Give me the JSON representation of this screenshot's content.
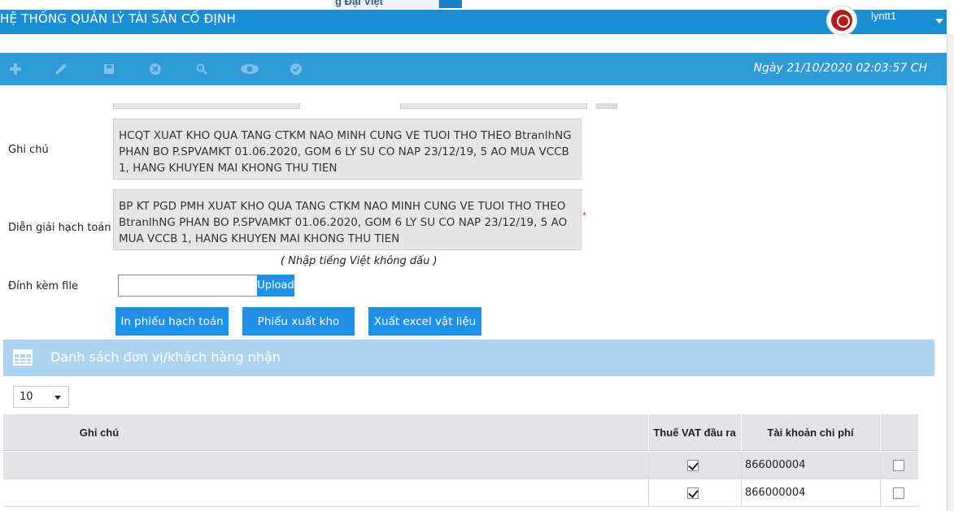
{
  "top_tab": {
    "label": "g Đại Việt"
  },
  "header": {
    "title": "HỆ THỐNG QUẢN LÝ TÀI SẢN CỐ ĐỊNH",
    "username": "lyntt1"
  },
  "toolbar": {
    "icons": [
      "add-icon",
      "edit-icon",
      "save-icon",
      "cancel-icon",
      "search-icon",
      "view-icon",
      "approve-icon"
    ],
    "datetime": "Ngày 21/10/2020   02:03:57 CH"
  },
  "form": {
    "note_label": "Ghi chú",
    "note_value": "HCQT XUAT KHO QUA TANG CTKM NAO MINH CUNG VE TUOI THO THEO BtranlhNG PHAN BO P.SPVAMKT 01.06.2020, GOM 6 LY SU CO NAP 23/12/19, 5 AO MUA VCCB 1, HANG KHUYEN MAI KHONG THU TIEN",
    "accounting_label": "Diễn giải hạch toán",
    "accounting_value": "BP KT PGD PMH XUAT KHO QUA TANG CTKM NAO MINH CUNG VE TUOI THO THEO BtranlhNG PHAN BO P.SPVAMKT 01.06.2020, GOM 6 LY SU CO NAP 23/12/19, 5 AO MUA VCCB 1, HANG KHUYEN MAI KHONG THU TIEN",
    "required_mark": "*",
    "hint": "( Nhập tiếng Việt không dấu )",
    "attach_label": "Đính kèm file",
    "upload_label": "Upload"
  },
  "actions": {
    "print_voucher": "In phiếu hạch toán",
    "issue_slip": "Phiếu xuất kho",
    "export_excel": "Xuất excel vật liệu"
  },
  "panel": {
    "title": "Danh sách đơn vị/khách hàng nhận"
  },
  "pagination": {
    "page_size": "10"
  },
  "table": {
    "columns": [
      "Ghi chú",
      "Thuế VAT đầu ra",
      "Tài khoản chi phí"
    ],
    "rows": [
      {
        "note": "",
        "vat": true,
        "account": "866000004",
        "selected": false
      },
      {
        "note": "",
        "vat": true,
        "account": "866000004",
        "selected": false
      }
    ]
  }
}
